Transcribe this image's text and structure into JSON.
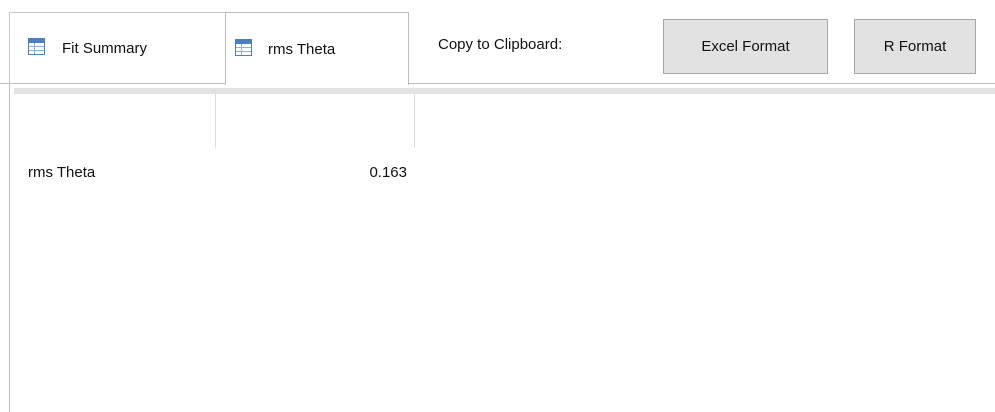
{
  "tabs": [
    {
      "label": "Fit Summary",
      "icon": "table-icon",
      "selected": false
    },
    {
      "label": "rms Theta",
      "icon": "table-icon",
      "selected": true
    }
  ],
  "toolbar": {
    "copy_label": "Copy to Clipboard:",
    "excel_button": "Excel Format",
    "r_button": "R Format"
  },
  "table": {
    "rows": [
      {
        "label": "rms Theta",
        "value": "0.163"
      }
    ]
  },
  "colors": {
    "icon_blue": "#4a7fc1",
    "button_bg": "#e2e2e2",
    "header_bar": "#e3e3e3"
  }
}
